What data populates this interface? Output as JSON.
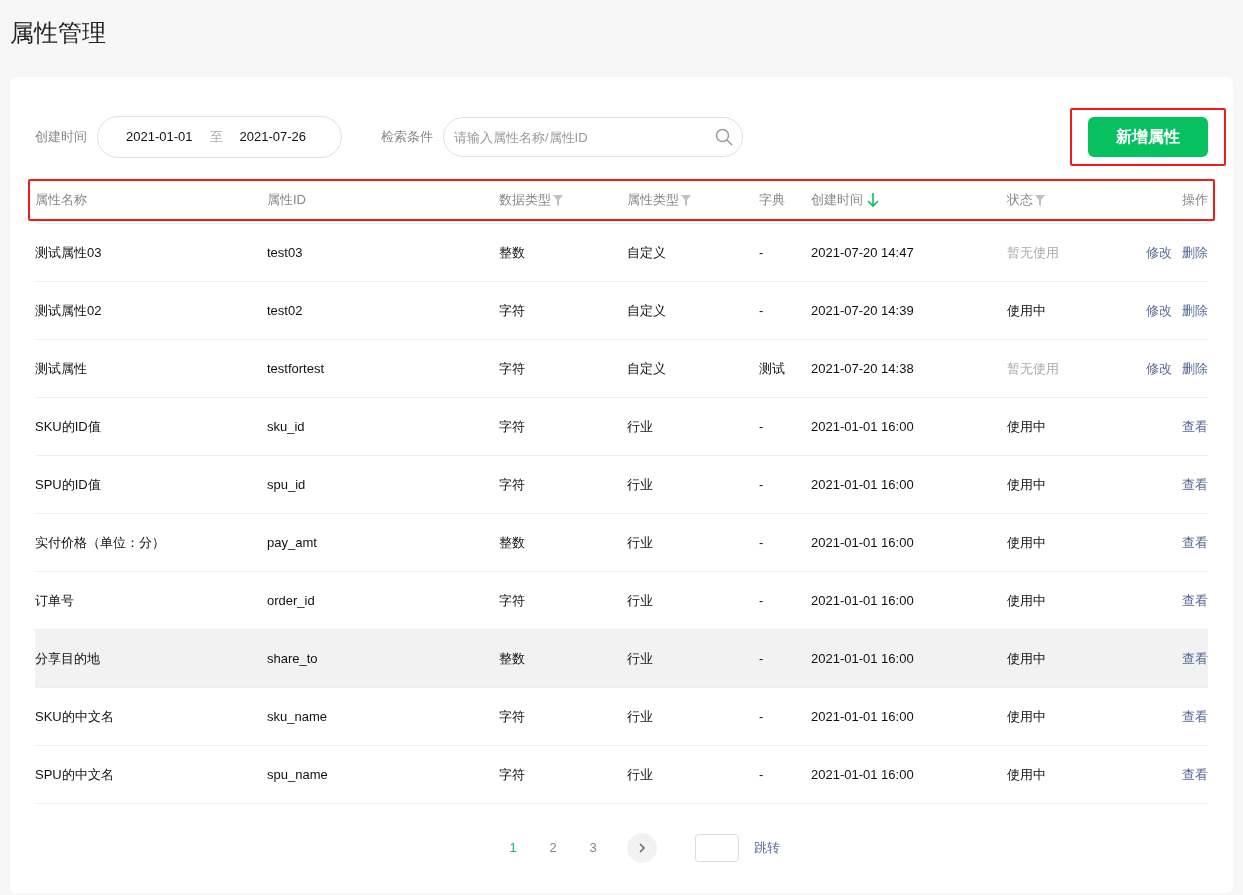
{
  "page_title": "属性管理",
  "filters": {
    "date_label": "创建时间",
    "date_from": "2021-01-01",
    "date_sep": "至",
    "date_to": "2021-07-26",
    "search_label": "检索条件",
    "search_placeholder": "请输入属性名称/属性ID"
  },
  "add_button": "新增属性",
  "columns": [
    {
      "label": "属性名称",
      "filter": false,
      "sorted": false
    },
    {
      "label": "属性ID",
      "filter": false,
      "sorted": false
    },
    {
      "label": "数据类型",
      "filter": true,
      "sorted": false
    },
    {
      "label": "属性类型",
      "filter": true,
      "sorted": false
    },
    {
      "label": "字典",
      "filter": false,
      "sorted": false
    },
    {
      "label": "创建时间",
      "filter": false,
      "sorted": true
    },
    {
      "label": "状态",
      "filter": true,
      "sorted": false
    },
    {
      "label": "操作",
      "filter": false,
      "sorted": false
    }
  ],
  "rows": [
    {
      "name": "测试属性03",
      "id": "test03",
      "data_type": "整数",
      "attr_type": "自定义",
      "dict": "-",
      "created": "2021-07-20 14:47",
      "status": "暂无使用",
      "in_use": false,
      "highlighted": false,
      "actions": [
        "修改",
        "删除"
      ]
    },
    {
      "name": "测试属性02",
      "id": "test02",
      "data_type": "字符",
      "attr_type": "自定义",
      "dict": "-",
      "created": "2021-07-20 14:39",
      "status": "使用中",
      "in_use": true,
      "highlighted": false,
      "actions": [
        "修改",
        "删除"
      ]
    },
    {
      "name": "测试属性",
      "id": "testfortest",
      "data_type": "字符",
      "attr_type": "自定义",
      "dict": "测试",
      "created": "2021-07-20 14:38",
      "status": "暂无使用",
      "in_use": false,
      "highlighted": false,
      "actions": [
        "修改",
        "删除"
      ]
    },
    {
      "name": "SKU的ID值",
      "id": "sku_id",
      "data_type": "字符",
      "attr_type": "行业",
      "dict": "-",
      "created": "2021-01-01 16:00",
      "status": "使用中",
      "in_use": true,
      "highlighted": false,
      "actions": [
        "查看"
      ]
    },
    {
      "name": "SPU的ID值",
      "id": "spu_id",
      "data_type": "字符",
      "attr_type": "行业",
      "dict": "-",
      "created": "2021-01-01 16:00",
      "status": "使用中",
      "in_use": true,
      "highlighted": false,
      "actions": [
        "查看"
      ]
    },
    {
      "name": "实付价格（单位：分）",
      "id": "pay_amt",
      "data_type": "整数",
      "attr_type": "行业",
      "dict": "-",
      "created": "2021-01-01 16:00",
      "status": "使用中",
      "in_use": true,
      "highlighted": false,
      "actions": [
        "查看"
      ]
    },
    {
      "name": "订单号",
      "id": "order_id",
      "data_type": "字符",
      "attr_type": "行业",
      "dict": "-",
      "created": "2021-01-01 16:00",
      "status": "使用中",
      "in_use": true,
      "highlighted": false,
      "actions": [
        "查看"
      ]
    },
    {
      "name": "分享目的地",
      "id": "share_to",
      "data_type": "整数",
      "attr_type": "行业",
      "dict": "-",
      "created": "2021-01-01 16:00",
      "status": "使用中",
      "in_use": true,
      "highlighted": true,
      "actions": [
        "查看"
      ]
    },
    {
      "name": "SKU的中文名",
      "id": "sku_name",
      "data_type": "字符",
      "attr_type": "行业",
      "dict": "-",
      "created": "2021-01-01 16:00",
      "status": "使用中",
      "in_use": true,
      "highlighted": false,
      "actions": [
        "查看"
      ]
    },
    {
      "name": "SPU的中文名",
      "id": "spu_name",
      "data_type": "字符",
      "attr_type": "行业",
      "dict": "-",
      "created": "2021-01-01 16:00",
      "status": "使用中",
      "in_use": true,
      "highlighted": false,
      "actions": [
        "查看"
      ]
    }
  ],
  "pagination": {
    "pages": [
      {
        "label": "1",
        "selected": true
      },
      {
        "label": "2",
        "selected": false
      },
      {
        "label": "3",
        "selected": false
      }
    ],
    "jump": "跳转"
  }
}
